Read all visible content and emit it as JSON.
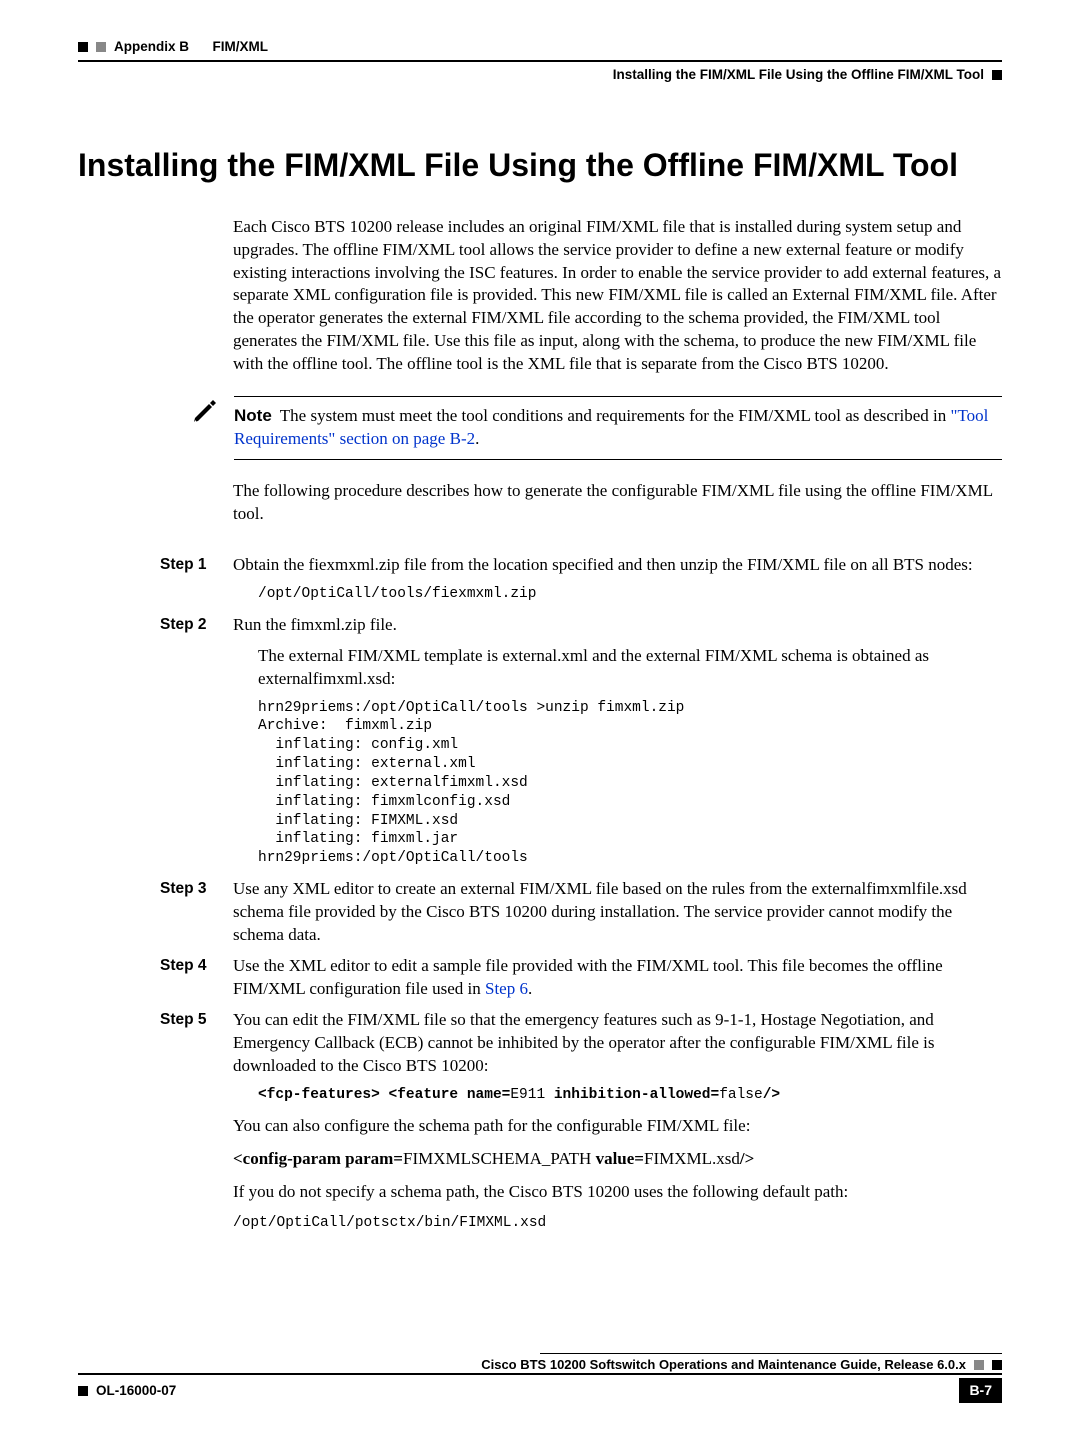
{
  "header": {
    "appendix": "Appendix B",
    "section": "FIM/XML",
    "subsection": "Installing the FIM/XML File Using the Offline FIM/XML Tool"
  },
  "title": "Installing the FIM/XML File Using the Offline FIM/XML Tool",
  "intro": "Each Cisco BTS 10200 release includes an original FIM/XML file that is installed during system setup and upgrades. The offline FIM/XML tool allows the service provider to define a new external feature or modify existing interactions involving the ISC features. In order to enable the service provider to add external features, a separate XML configuration file is provided. This new FIM/XML file is called an External FIM/XML file. After the operator generates the external FIM/XML file according to the schema provided, the FIM/XML tool generates the FIM/XML file. Use this file as input, along with the schema, to produce the new FIM/XML file with the offline tool. The offline tool is the XML file that is separate from the Cisco BTS 10200.",
  "note": {
    "label": "Note",
    "text_before_link": "The system must meet the tool conditions and requirements for the FIM/XML tool as described in ",
    "link_text": "\"Tool Requirements\" section on page B-2",
    "text_after_link": "."
  },
  "follow_para": "The following procedure describes how to generate the configurable FIM/XML file using the offline FIM/XML tool.",
  "steps": {
    "s1": {
      "label": "Step 1",
      "text": "Obtain the fiexmxml.zip file from the location specified and then unzip the FIM/XML file on all BTS nodes:",
      "code": "/opt/OptiCall/tools/fiexmxml.zip"
    },
    "s2": {
      "label": "Step 2",
      "text": "Run the fimxml.zip file.",
      "sub": "The external FIM/XML template is external.xml and the external FIM/XML schema is obtained as externalfimxml.xsd:",
      "code": "hrn29priems:/opt/OptiCall/tools >unzip fimxml.zip\nArchive:  fimxml.zip\n  inflating: config.xml\n  inflating: external.xml\n  inflating: externalfimxml.xsd\n  inflating: fimxmlconfig.xsd\n  inflating: FIMXML.xsd\n  inflating: fimxml.jar\nhrn29priems:/opt/OptiCall/tools"
    },
    "s3": {
      "label": "Step 3",
      "text": "Use any XML editor to create an external FIM/XML file based on the rules from the externalfimxmlfile.xsd schema file provided by the Cisco BTS 10200 during installation. The service provider cannot modify the schema data."
    },
    "s4": {
      "label": "Step 4",
      "text_before_link": "Use the XML editor to edit a sample file provided with the FIM/XML tool. This file becomes the offline FIM/XML configuration file used in ",
      "link_text": "Step 6",
      "text_after_link": "."
    },
    "s5": {
      "label": "Step 5",
      "text": "You can edit the FIM/XML file so that the emergency features such as 9-1-1, Hostage Negotiation, and Emergency Callback (ECB) cannot be inhibited by the operator after the configurable FIM/XML file is downloaded to the Cisco BTS 10200:",
      "code_bold1": "<fcp-features> <feature name=",
      "code_plain1": "E911",
      "code_bold2": " inhibition-allowed=",
      "code_plain2": "false",
      "code_bold3": "/>",
      "after1": "You can also configure the schema path for the configurable FIM/XML file:",
      "cfg_bold1": "<config-param param=",
      "cfg_plain1": "FIMXMLSCHEMA_PATH ",
      "cfg_bold2": "value=",
      "cfg_plain2": "FIMXML.xsd",
      "cfg_bold3": "/>",
      "after2": "If you do not specify a schema path, the Cisco BTS 10200 uses the following default path:",
      "code_path": "/opt/OptiCall/potsctx/bin/FIMXML.xsd"
    }
  },
  "footer": {
    "guide": "Cisco BTS 10200 Softswitch Operations and Maintenance Guide, Release 6.0.x",
    "doc_id": "OL-16000-07",
    "page": "B-7"
  }
}
